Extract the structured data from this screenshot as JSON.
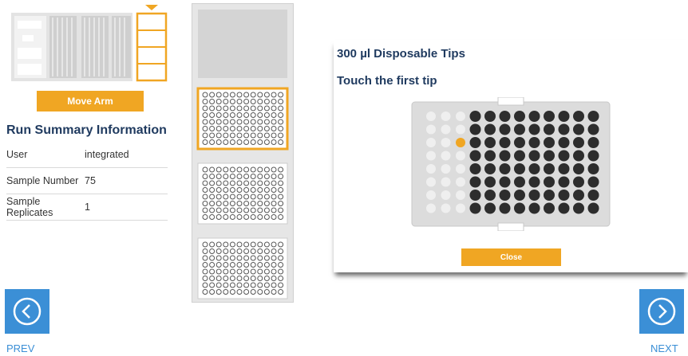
{
  "deck": {
    "move_arm_label": "Move Arm"
  },
  "summary": {
    "title": "Run Summary Information",
    "rows": [
      {
        "label": "User",
        "value": "integrated"
      },
      {
        "label": "Sample Number",
        "value": "75"
      },
      {
        "label": "Sample Replicates",
        "value": "1"
      }
    ]
  },
  "modal": {
    "title": "300 µl Disposable Tips",
    "instruction": "Touch the first tip",
    "close_label": "Close",
    "rack": {
      "rows": 8,
      "columns": 12,
      "used_columns": 3,
      "highlighted_tip": {
        "row": 3,
        "column": 3
      }
    }
  },
  "nav": {
    "prev_label": "PREV",
    "next_label": "NEXT"
  },
  "colors": {
    "accent": "#f0a623",
    "primary": "#3b8fd6",
    "heading": "#1f3a5f",
    "tip_full": "#2d2d2d",
    "tip_empty": "#dcdcdc"
  }
}
